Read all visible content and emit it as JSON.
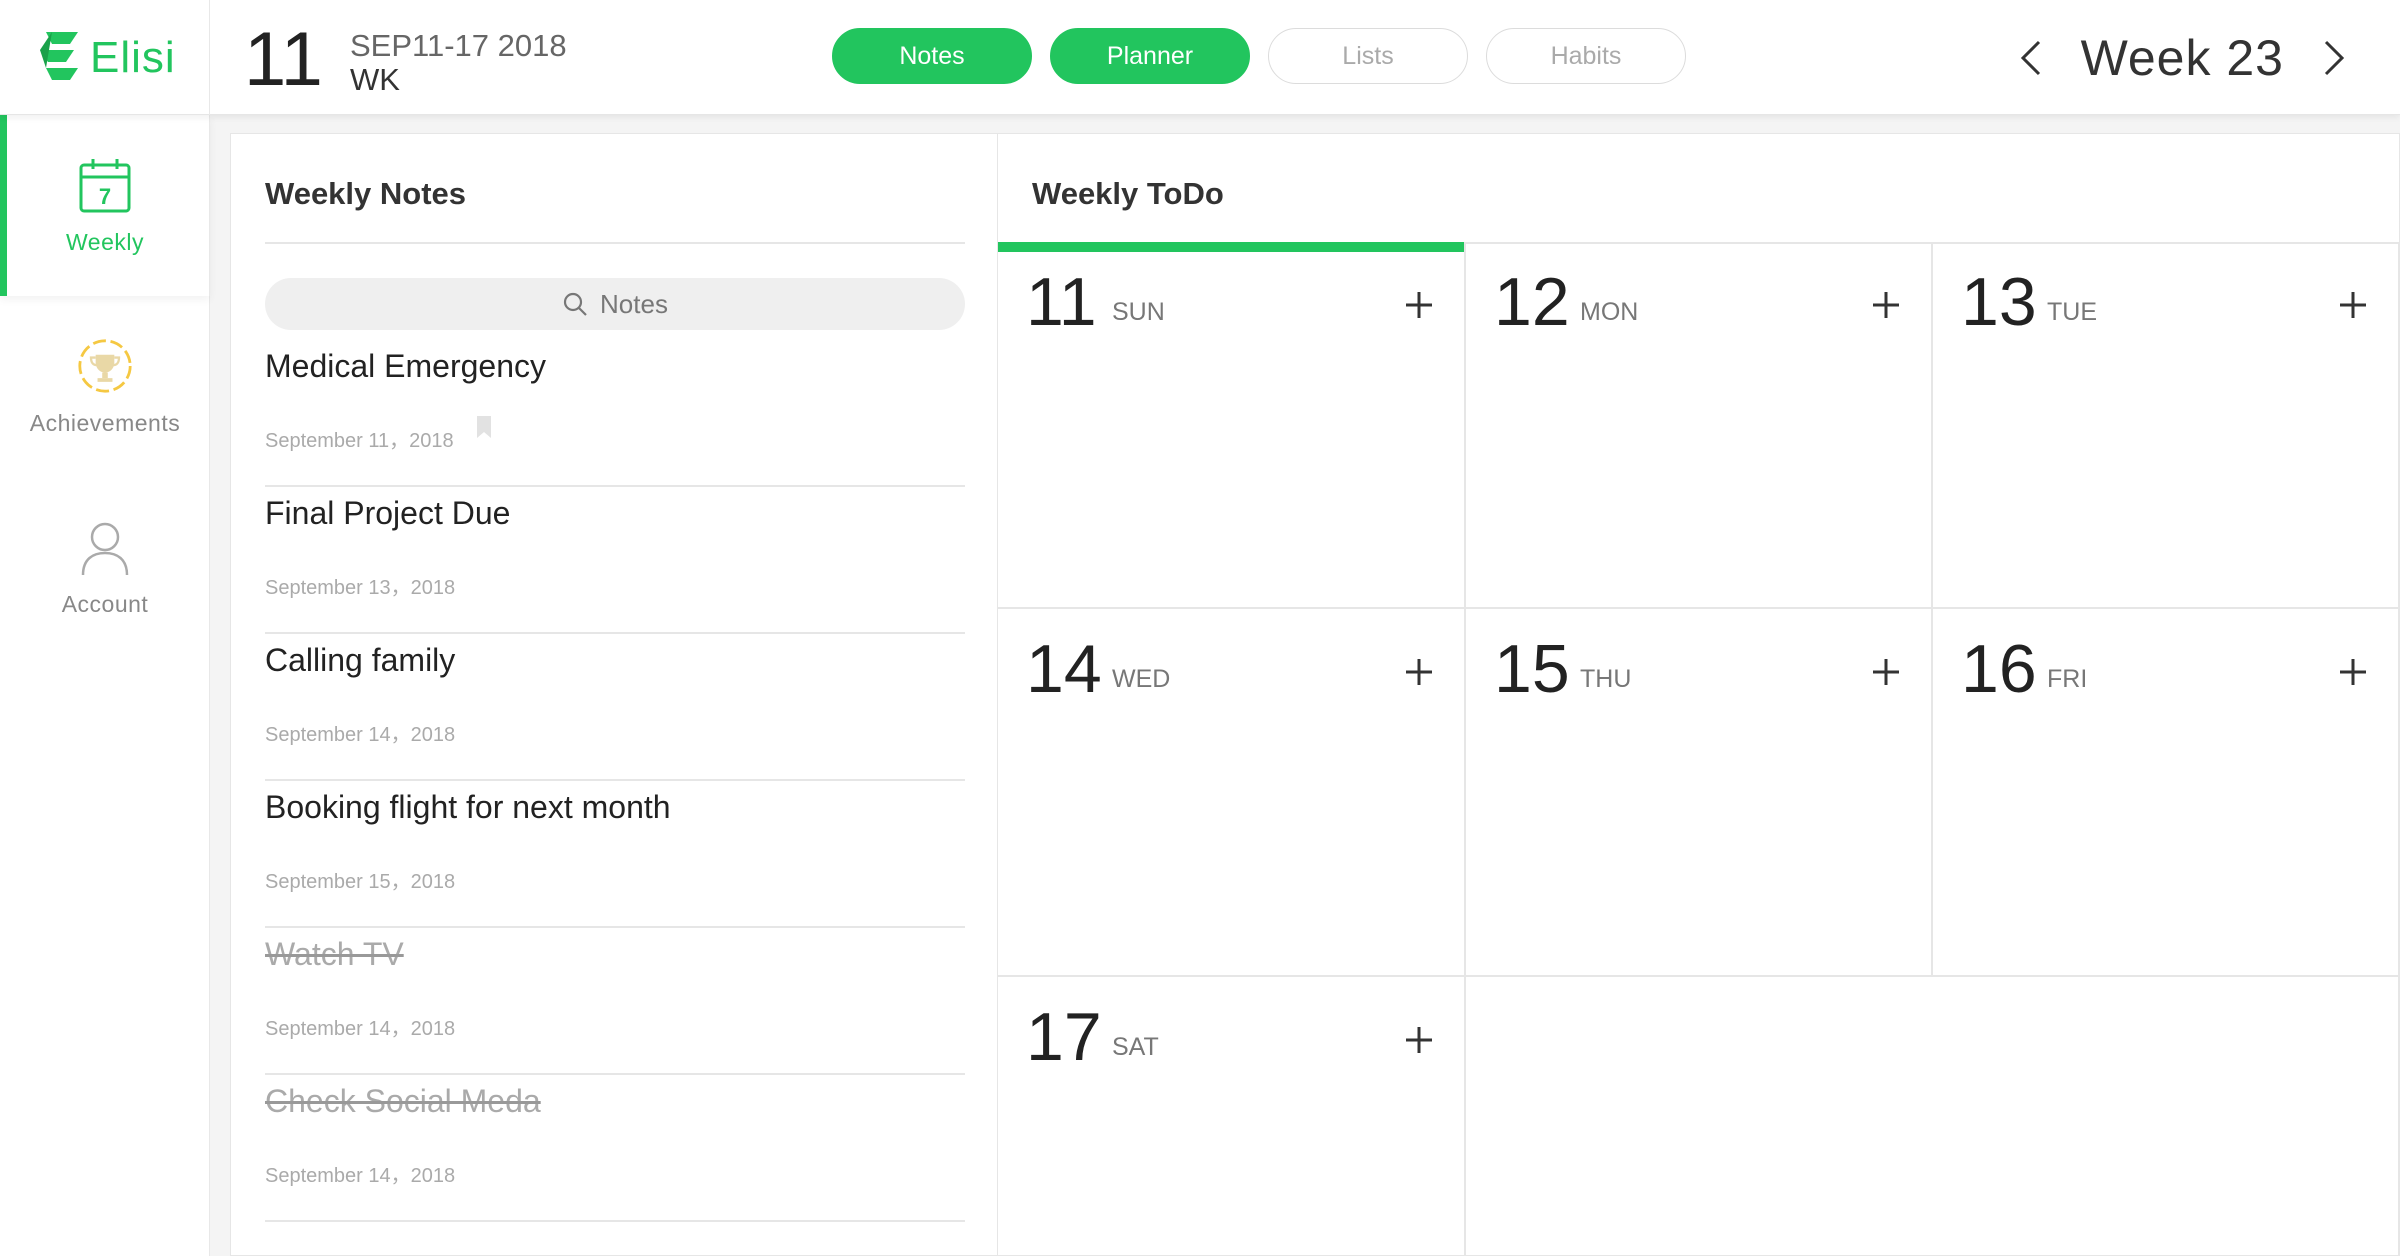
{
  "app": {
    "name": "Elisi",
    "brand_color": "#22c55e"
  },
  "header": {
    "date_day": "11",
    "date_range": "SEP11-17 2018",
    "date_unit": "WK",
    "tabs": [
      {
        "label": "Notes",
        "active": true
      },
      {
        "label": "Planner",
        "active": true
      },
      {
        "label": "Lists",
        "active": false
      },
      {
        "label": "Habits",
        "active": false
      }
    ],
    "week_label": "Week 23"
  },
  "sidebar": {
    "items": [
      {
        "label": "Weekly",
        "icon": "calendar-icon",
        "icon_text": "7",
        "active": true
      },
      {
        "label": "Achievements",
        "icon": "trophy-icon",
        "active": false
      },
      {
        "label": "Account",
        "icon": "user-icon",
        "active": false
      }
    ]
  },
  "notes": {
    "title": "Weekly Notes",
    "search_placeholder": "Notes",
    "items": [
      {
        "title": "Medical Emergency",
        "date": "September 11，2018",
        "bookmarked": true,
        "done": false
      },
      {
        "title": "Final Project Due",
        "date": "September 13，2018",
        "bookmarked": false,
        "done": false
      },
      {
        "title": "Calling family",
        "date": "September 14，2018",
        "bookmarked": false,
        "done": false
      },
      {
        "title": "Booking flight for next month",
        "date": "September 15，2018",
        "bookmarked": false,
        "done": false
      },
      {
        "title": "Watch TV",
        "date": "September 14，2018",
        "bookmarked": false,
        "done": true
      },
      {
        "title": "Check Social Meda",
        "date": "September 14，2018",
        "bookmarked": false,
        "done": true
      }
    ]
  },
  "todo": {
    "title": "Weekly ToDo",
    "days": [
      {
        "num": "11",
        "name": "SUN",
        "selected": true
      },
      {
        "num": "12",
        "name": "MON",
        "selected": false
      },
      {
        "num": "13",
        "name": "TUE",
        "selected": false
      },
      {
        "num": "14",
        "name": "WED",
        "selected": false
      },
      {
        "num": "15",
        "name": "THU",
        "selected": false
      },
      {
        "num": "16",
        "name": "FRI",
        "selected": false
      },
      {
        "num": "17",
        "name": "SAT",
        "selected": false
      }
    ]
  }
}
